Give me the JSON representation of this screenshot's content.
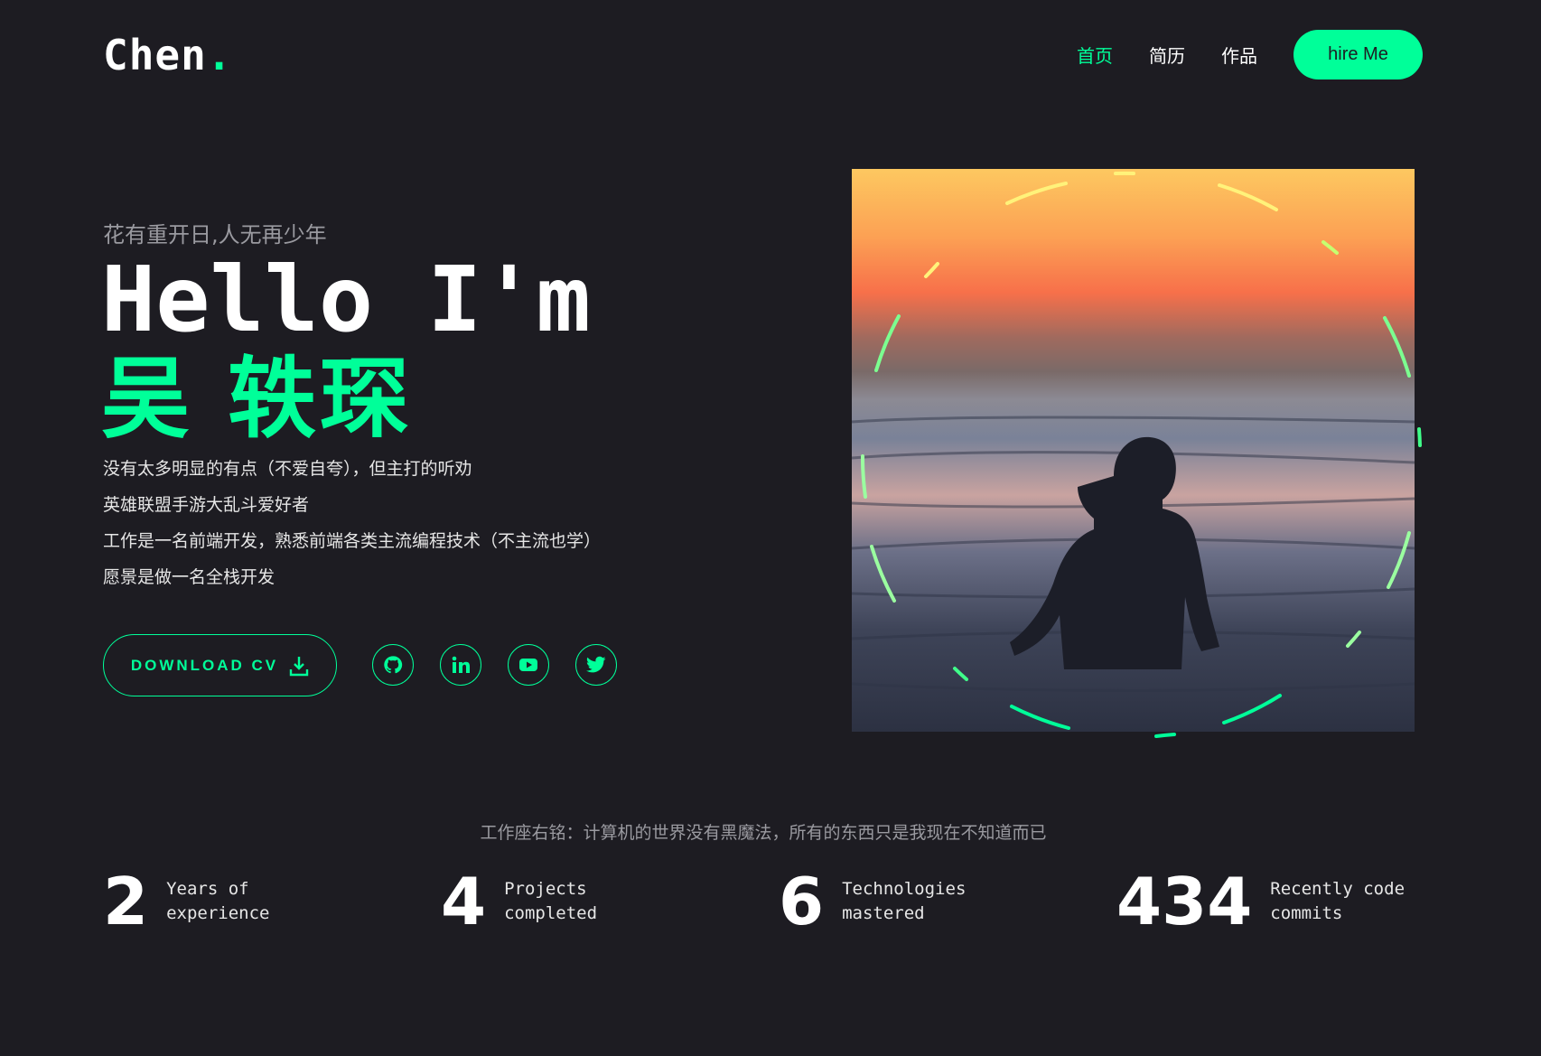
{
  "logo": {
    "text": "Chen",
    "dot": "."
  },
  "nav": {
    "items": [
      "首页",
      "简历",
      "作品"
    ],
    "active": 0,
    "hire_label": "hire Me"
  },
  "hero": {
    "motto": "花有重开日,人无再少年",
    "greeting": "Hello I'm",
    "name": "吴 轶琛",
    "lines": [
      "没有太多明显的有点（不爱自夸），但主打的听劝",
      "英雄联盟手游大乱斗爱好者",
      "工作是一名前端开发，熟悉前端各类主流编程技术（不主流也学）",
      "愿景是做一名全栈开发"
    ],
    "download_label": "DOWNLOAD CV",
    "socials": [
      "github-icon",
      "linkedin-icon",
      "youtube-icon",
      "twitter-icon"
    ]
  },
  "quote": "工作座右铭：计算机的世界没有黑魔法，所有的东西只是我现在不知道而已",
  "stats": [
    {
      "value": "2",
      "label": "Years of\nexperience"
    },
    {
      "value": "4",
      "label": "Projects\ncompleted"
    },
    {
      "value": "6",
      "label": "Technologies\nmastered"
    },
    {
      "value": "434",
      "label": "Recently code\ncommits"
    }
  ],
  "colors": {
    "accent": "#00ff99",
    "background": "#1d1c22"
  }
}
